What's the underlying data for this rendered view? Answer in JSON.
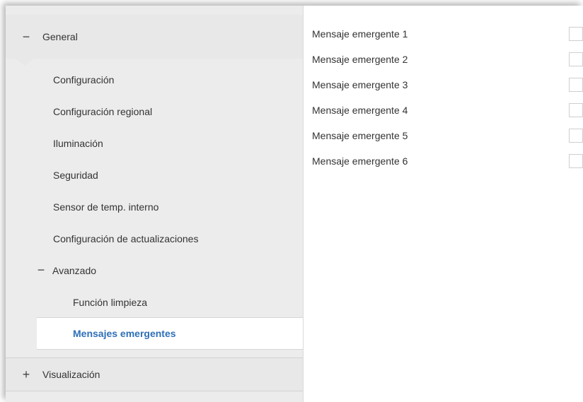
{
  "tree": {
    "general": {
      "sign": "−",
      "label": "General"
    },
    "items": [
      "Configuración",
      "Configuración regional",
      "Iluminación",
      "Seguridad",
      "Sensor de temp. interno",
      "Configuración de actualizaciones"
    ],
    "advanced": {
      "sign": "−",
      "label": "Avanzado"
    },
    "advanced_items": [
      "Función limpieza",
      "Mensajes emergentes"
    ],
    "visualization": {
      "sign": "+",
      "label": "Visualización"
    }
  },
  "params": [
    {
      "label": "Mensaje emergente 1",
      "checked": false
    },
    {
      "label": "Mensaje emergente 2",
      "checked": false
    },
    {
      "label": "Mensaje emergente 3",
      "checked": false
    },
    {
      "label": "Mensaje emergente 4",
      "checked": false
    },
    {
      "label": "Mensaje emergente 5",
      "checked": false
    },
    {
      "label": "Mensaje emergente 6",
      "checked": false
    }
  ],
  "colors": {
    "selected_text": "#2e6fb7",
    "panel_bg": "#ececec"
  }
}
